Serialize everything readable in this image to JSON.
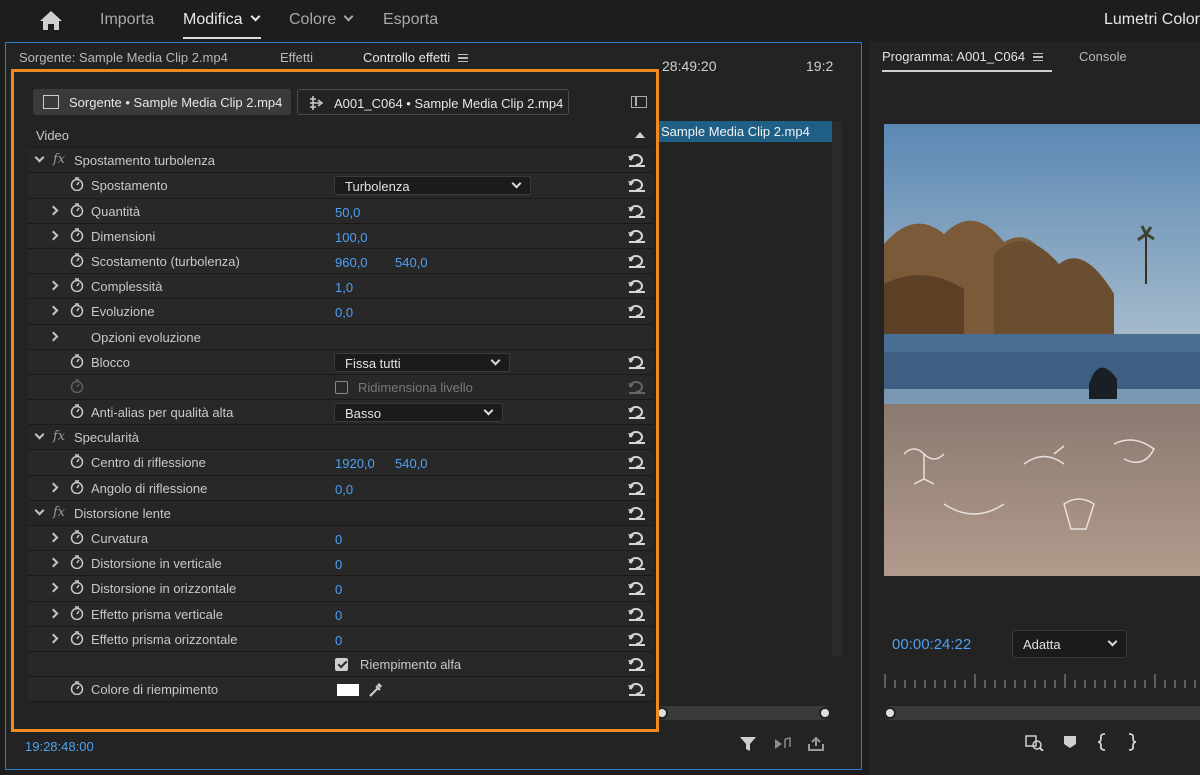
{
  "menu": {
    "items": [
      {
        "label": "Importa"
      },
      {
        "label": "Modifica"
      },
      {
        "label": "Colore"
      },
      {
        "label": "Esporta"
      }
    ],
    "right_label": "Lumetri Color"
  },
  "left_panel": {
    "tabs": {
      "source": "Sorgente: Sample Media Clip 2.mp4",
      "effects": "Effetti",
      "effect_controls": "Controllo effetti"
    },
    "timeline": {
      "ruler_a": "28:49:20",
      "ruler_b": "19:2",
      "clip_label": "Sample Media Clip 2.mp4"
    },
    "current_time": "19:28:48:00"
  },
  "effect_controls": {
    "source_button": "Sorgente • Sample Media Clip 2.mp4",
    "sequence_button": "A001_C064 • Sample Media Clip 2.mp4",
    "section_video": "Video",
    "turbulent": {
      "name": "Spostamento turbolenza",
      "displacement_label": "Spostamento",
      "displacement_value": "Turbolenza",
      "amount_label": "Quantità",
      "amount_value": "50,0",
      "size_label": "Dimensioni",
      "size_value": "100,0",
      "offset_label": "Scostamento (turbolenza)",
      "offset_x": "960,0",
      "offset_y": "540,0",
      "complexity_label": "Complessità",
      "complexity_value": "1,0",
      "evolution_label": "Evoluzione",
      "evolution_value": "0,0",
      "evolution_options_label": "Opzioni evoluzione",
      "pinning_label": "Blocco",
      "pinning_value": "Fissa tutti",
      "resize_layer_label": "Ridimensiona livello",
      "antialias_label": "Anti-alias per qualità alta",
      "antialias_value": "Basso"
    },
    "mirror": {
      "name": "Specularità",
      "center_label": "Centro di riflessione",
      "center_x": "1920,0",
      "center_y": "540,0",
      "angle_label": "Angolo di riflessione",
      "angle_value": "0,0"
    },
    "lens": {
      "name": "Distorsione lente",
      "curvature_label": "Curvatura",
      "curvature_value": "0",
      "vdecenter_label": "Distorsione in verticale",
      "vdecenter_value": "0",
      "hdecenter_label": "Distorsione in orizzontale",
      "hdecenter_value": "0",
      "vprism_label": "Effetto prisma verticale",
      "vprism_value": "0",
      "hprism_label": "Effetto prisma orizzontale",
      "hprism_value": "0",
      "fill_alpha_label": "Riempimento alfa",
      "fill_color_label": "Colore di riempimento",
      "fill_color": "#ffffff"
    }
  },
  "program": {
    "tab_label": "Programma: A001_C064",
    "console_label": "Console",
    "timecode": "00:00:24:22",
    "fit_value": "Adatta"
  },
  "colors": {
    "accent_blue": "#4ea0f2",
    "highlight_orange": "#f08a1c",
    "panel_border": "#2f7fd3"
  }
}
